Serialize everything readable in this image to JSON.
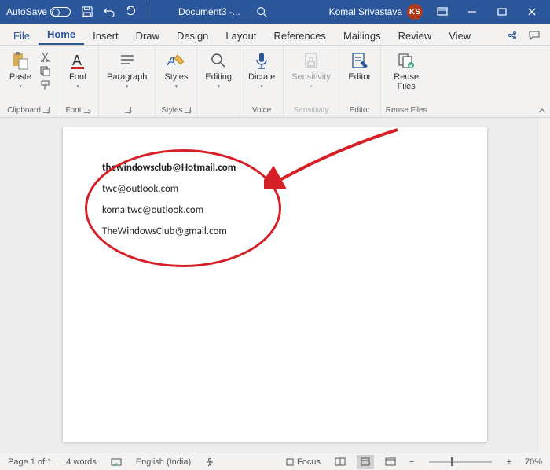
{
  "titlebar": {
    "autosave_label": "AutoSave",
    "autosave_state": "Off",
    "doc_title": "Document3  -...",
    "user_name": "Komal Srivastava",
    "user_initials": "KS"
  },
  "tabs": {
    "file": "File",
    "list": [
      "Home",
      "Insert",
      "Draw",
      "Design",
      "Layout",
      "References",
      "Mailings",
      "Review",
      "View"
    ],
    "active_index": 0
  },
  "ribbon": {
    "clipboard": {
      "paste": "Paste",
      "label": "Clipboard"
    },
    "font": {
      "btn": "Font",
      "label": "Font"
    },
    "paragraph": {
      "btn": "Paragraph",
      "label": ""
    },
    "styles": {
      "btn": "Styles",
      "label": "Styles"
    },
    "editing": {
      "btn": "Editing",
      "label": ""
    },
    "voice": {
      "btn": "Dictate",
      "label": "Voice"
    },
    "sensitivity": {
      "btn": "Sensitivity",
      "label": "Sensitivity"
    },
    "editor": {
      "btn": "Editor",
      "label": "Editor"
    },
    "reuse": {
      "btn": "Reuse",
      "btn2": "Files",
      "label": "Reuse Files"
    }
  },
  "document": {
    "lines": [
      "thewindowsclub@Hotmail.com",
      "twc@outlook.com",
      "komaltwc@outlook.com",
      "TheWindowsClub@gmail.com"
    ]
  },
  "statusbar": {
    "page": "Page 1 of 1",
    "words": "4 words",
    "language": "English (India)",
    "focus": "Focus",
    "zoom": "70%"
  }
}
